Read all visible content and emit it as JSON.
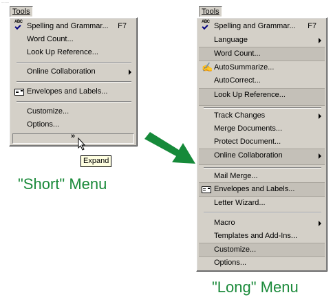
{
  "corner_label": "..........",
  "short_menu": {
    "menubar_title": "Tools",
    "items": [
      {
        "label": "Spelling and Grammar...",
        "shortcut": "F7",
        "icon": "spelling-check-icon"
      },
      {
        "label": "Word Count..."
      },
      {
        "label": "Look Up Reference..."
      },
      {
        "label": "Online Collaboration",
        "submenu": true
      },
      {
        "label": "Envelopes and Labels...",
        "icon": "envelope-icon"
      },
      {
        "label": "Customize..."
      },
      {
        "label": "Options..."
      }
    ],
    "expand_glyph": "»",
    "tooltip": "Expand",
    "caption": "\"Short\" Menu"
  },
  "long_menu": {
    "menubar_title": "Tools",
    "items": [
      {
        "label": "Spelling and Grammar...",
        "shortcut": "F7",
        "icon": "spelling-check-icon"
      },
      {
        "label": "Language",
        "submenu": true
      },
      {
        "label": "Word Count..."
      },
      {
        "label": "AutoSummarize...",
        "icon": "autosummarize-icon"
      },
      {
        "label": "AutoCorrect..."
      },
      {
        "label": "Look Up Reference..."
      },
      {
        "label": "Track Changes",
        "submenu": true
      },
      {
        "label": "Merge Documents..."
      },
      {
        "label": "Protect Document..."
      },
      {
        "label": "Online Collaboration",
        "submenu": true
      },
      {
        "label": "Mail Merge..."
      },
      {
        "label": "Envelopes and Labels...",
        "icon": "envelope-icon"
      },
      {
        "label": "Letter Wizard..."
      },
      {
        "label": "Macro",
        "submenu": true
      },
      {
        "label": "Templates and Add-Ins..."
      },
      {
        "label": "Customize..."
      },
      {
        "label": "Options..."
      }
    ],
    "caption": "\"Long\" Menu"
  },
  "colors": {
    "menu_face": "#d4d0c8",
    "caption_green": "#1a8a3a",
    "arrow_green": "#168a3a",
    "tooltip_bg": "#ffffe1"
  }
}
